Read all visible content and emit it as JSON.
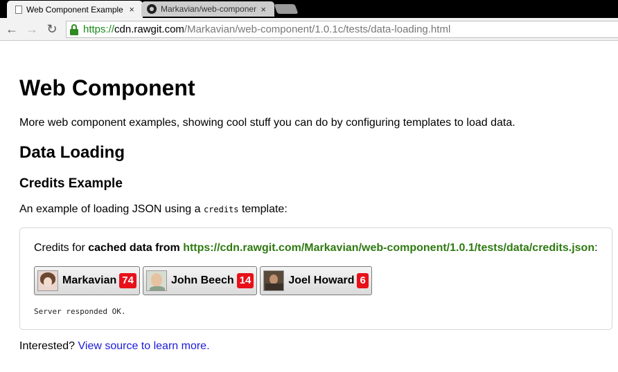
{
  "browser": {
    "tabs": [
      {
        "title": "Web Component Example",
        "icon": "document-icon",
        "close": "×"
      },
      {
        "title": "Markavian/web-component",
        "icon": "github-icon",
        "close": "×"
      }
    ],
    "nav": {
      "back": "←",
      "forward": "→",
      "reload": "↻"
    },
    "url": {
      "scheme": "https://",
      "host": "cdn.rawgit.com",
      "path": "/Markavian/web-component/1.0.1c/tests/data-loading.html"
    }
  },
  "page": {
    "title": "Web Component",
    "intro": "More web component examples, showing cool stuff you can do by configuring templates to load data.",
    "section_title": "Data Loading",
    "example_title": "Credits Example",
    "example_desc_before": "An example of loading JSON using a ",
    "example_desc_code": "credits",
    "example_desc_after": " template:",
    "credits": {
      "prefix": "Credits for ",
      "bold": "cached data from ",
      "link": "https://cdn.rawgit.com/Markavian/web-component/1.0.1/tests/data/credits.json",
      "suffix": ":",
      "people": [
        {
          "name": "Markavian",
          "count": "74"
        },
        {
          "name": "John Beech",
          "count": "14"
        },
        {
          "name": "Joel Howard",
          "count": "6"
        }
      ],
      "status": "Server responded OK."
    },
    "footer_prefix": "Interested? ",
    "footer_link": "View source to learn more."
  },
  "colors": {
    "link_green": "#2f7a12",
    "link_blue": "#1a1adb",
    "badge_red": "#e8101a",
    "secure_green": "#1a8a1a"
  }
}
